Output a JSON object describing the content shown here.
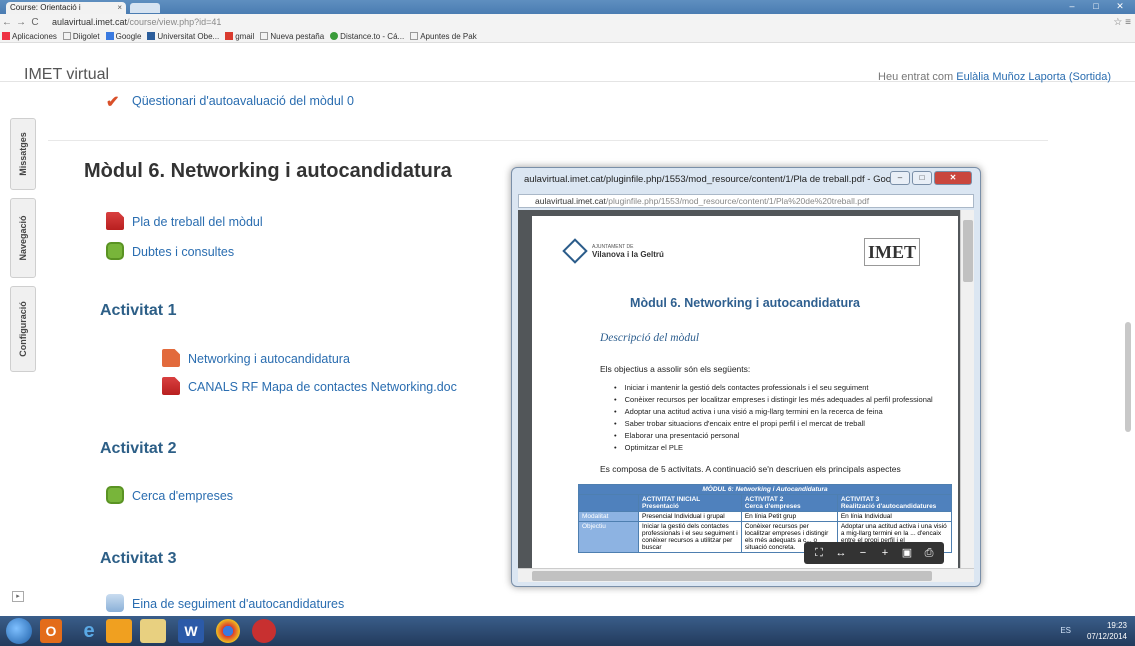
{
  "browser": {
    "tab_title": "Course: Orientació i",
    "tab_close": "×",
    "url_host": "aulavirtual.imet.cat",
    "url_path": "/course/view.php?id=41",
    "window_min": "–",
    "window_max": "□",
    "window_close": "✕",
    "bookmarks": [
      "Aplicaciones",
      "Diigolet",
      "Google",
      "Universitat Obe...",
      "gmail",
      "Nueva pestaña",
      "Distance.to - Cá...",
      "Apuntes de Pak"
    ]
  },
  "header": {
    "brand": "IMET virtual",
    "login_prefix": "Heu entrat com ",
    "user_name": "Eulàlia Muñoz Laporta",
    "logout": "(Sortida)"
  },
  "dock": {
    "items": [
      "Missatges",
      "Navegació",
      "Configuració"
    ]
  },
  "main": {
    "prev_item": "Qüestionari d'autoavaluació del mòdul 0",
    "module_title": "Mòdul 6. Networking i autocandidatura",
    "module_items": [
      "Pla de treball del mòdul",
      "Dubtes i consultes"
    ],
    "activities": [
      {
        "title": "Activitat 1",
        "items": [
          "Networking i autocandidatura",
          "CANALS RF Mapa de contactes Networking.doc"
        ]
      },
      {
        "title": "Activitat 2",
        "items": [
          "Cerca d'empreses"
        ]
      },
      {
        "title": "Activitat 3",
        "items": [
          "Eina de seguiment d'autocandidatures"
        ]
      }
    ]
  },
  "popup": {
    "title": "aulavirtual.imet.cat/pluginfile.php/1553/mod_resource/content/1/Pla de treball.pdf - Google ...",
    "url_host": "aulavirtual.imet.cat",
    "url_path": "/pluginfile.php/1553/mod_resource/content/1/Pla%20de%20treball.pdf",
    "doc": {
      "logo_small": "AJUNTAMENT DE",
      "logo_name": "Vilanova i la Geltrú",
      "imet_logo": "IMET",
      "title": "Mòdul 6. Networking i autocandidatura",
      "subtitle": "Descripció del mòdul",
      "intro": "Els objectius a assolir són els següents:",
      "objectives": [
        "Iniciar i mantenir la gestió dels contactes professionals i el seu seguiment",
        "Conèixer recursos per localitzar empreses i distingir les més adequades al perfil professional",
        "Adoptar una actitud activa i una visió a mig-llarg termini en la recerca de feina",
        "Saber trobar situacions d'encaix entre el propi perfil i el mercat de treball",
        "Elaborar una presentació personal",
        "Optimitzar el PLE"
      ],
      "composition": "Es composa de 5 activitats. A continuació se'n descriuen els principals aspectes",
      "table": {
        "header": "MÒDUL 6: Networking i Autocandidatura",
        "columns": [
          {
            "name": "ACTIVITAT INICIAL",
            "sub": "Presentació"
          },
          {
            "name": "ACTIVITAT 2",
            "sub": "Cerca d'empreses"
          },
          {
            "name": "ACTIVITAT 3",
            "sub": "Realització d'autocandidatures"
          }
        ],
        "rows": [
          {
            "label": "Modalitat",
            "cells": [
              "Presencial Individual i grupal",
              "En línia Petit grup",
              "En línia Individual"
            ]
          },
          {
            "label": "Objectiu",
            "cells": [
              "Iniciar la gestió dels contactes professionals i el seu seguiment i conèixer recursos a utilitzar per buscar",
              "Conèixer recursos per localitzar empreses i distingir els més adequats a c... o situació concreta.",
              "Adoptar una actitud activa i una visió a mig-llarg termini en la ... d'encaix entre el propi perfil i el"
            ]
          }
        ]
      }
    }
  },
  "taskbar": {
    "lang": "ES",
    "time": "19:23",
    "date": "07/12/2014"
  }
}
